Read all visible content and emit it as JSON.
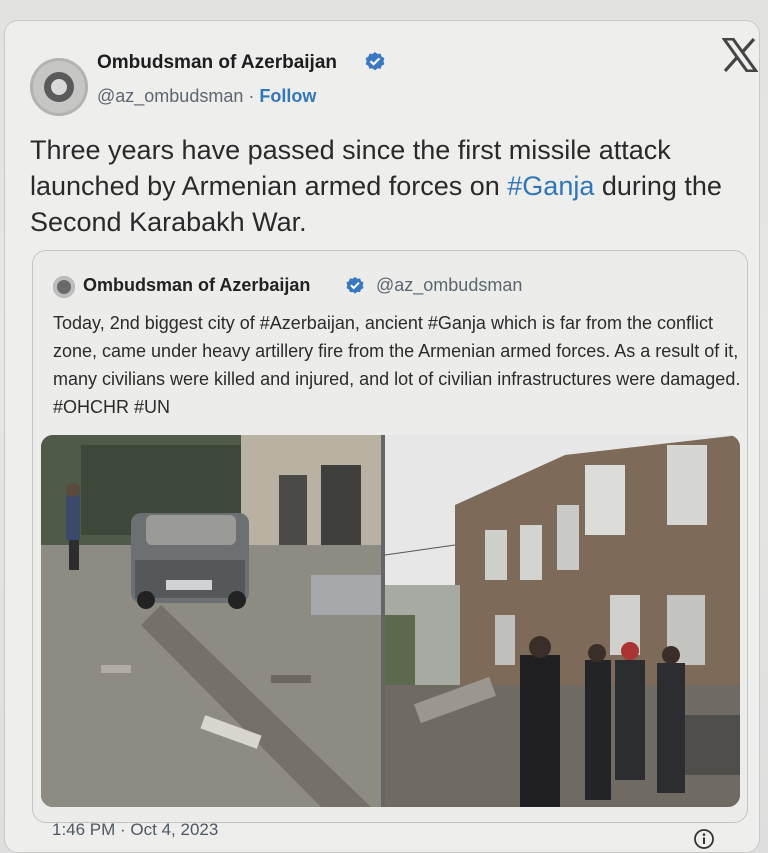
{
  "tweet": {
    "author_name": "Ombudsman of Azerbaijan",
    "handle": "@az_ombudsman",
    "separator": " · ",
    "follow_label": "Follow",
    "text_before": "Three years have passed since the first missile attack launched by Armenian armed forces on ",
    "hashtag": "#Ganja",
    "text_after": " during the Second Karabakh War.",
    "timestamp": "1:46 PM · Oct 4, 2023",
    "icons": {
      "avatar": "ombudsman-emblem-icon",
      "verified": "verified-badge-icon",
      "platform": "x-logo-icon",
      "info": "info-icon"
    }
  },
  "quoted": {
    "author_name": "Ombudsman of Azerbaijan",
    "handle": "@az_ombudsman",
    "text": "Today, 2nd biggest city of #Azerbaijan, ancient #Ganja which is far from the conflict zone, came under heavy artillery fire from the Armenian armed forces. As a result of it, many civilians were killed and injured, and lot of civilian infrastructures were damaged. #OHCHR #UN",
    "photos": [
      "damaged-street-with-car",
      "damaged-building-with-people"
    ]
  },
  "colors": {
    "link": "#2f76b9",
    "verified": "#3a78c0",
    "text": "#2a2a2a",
    "secondary": "#5b6670"
  }
}
